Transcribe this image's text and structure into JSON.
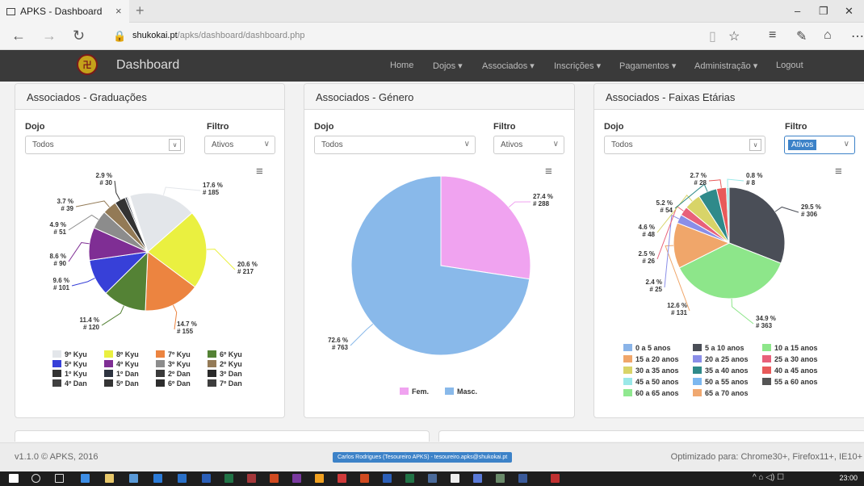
{
  "browser": {
    "tab_title": "APKS - Dashboard",
    "tab_close": "×",
    "new_tab": "+",
    "url_host": "shukokai.pt",
    "url_path": "/apks/dashboard/dashboard.php",
    "back": "←",
    "forward": "→",
    "refresh": "↻",
    "minimize": "–",
    "restore": "❐",
    "close": "✕"
  },
  "navbar": {
    "brand": "Dashboard",
    "items": [
      "Home",
      "Dojos ▾",
      "Associados ▾",
      "Inscrições ▾",
      "Pagamentos ▾",
      "Administração ▾",
      "Logout"
    ]
  },
  "panels": {
    "grad": {
      "title": "Associados - Graduações",
      "dojo_label": "Dojo",
      "dojo_value": "Todos",
      "filter_label": "Filtro",
      "filter_value": "Ativos"
    },
    "genero": {
      "title": "Associados - Género",
      "dojo_label": "Dojo",
      "dojo_value": "Todos",
      "filter_label": "Filtro",
      "filter_value": "Ativos"
    },
    "faixas": {
      "title": "Associados - Faixas Etárias",
      "dojo_label": "Dojo",
      "dojo_value": "Todos",
      "filter_label": "Filtro",
      "filter_value": "Ativos"
    }
  },
  "chart_data": [
    {
      "type": "pie",
      "title": "",
      "series": [
        {
          "categories": [
            "9º Kyu",
            "8º Kyu",
            "7º Kyu",
            "6º Kyu",
            "5º Kyu",
            "4º Kyu",
            "3º Kyu",
            "2º Kyu",
            "1º Kyu",
            "1º Dan",
            "2º Dan",
            "3º Dan",
            "4º Dan",
            "5º Dan",
            "6º Dan",
            "7º Dan"
          ],
          "values": [
            185,
            217,
            155,
            120,
            101,
            90,
            51,
            39,
            30,
            5,
            3,
            2,
            1,
            1,
            1,
            1
          ],
          "percent": [
            17.6,
            20.6,
            14.7,
            11.4,
            9.6,
            8.6,
            4.9,
            3.7,
            2.9,
            0.5,
            0.3,
            0.2,
            0.1,
            0.1,
            0.1,
            0.1
          ],
          "colors": [
            "#e3e6ea",
            "#eaf040",
            "#ec8440",
            "#548235",
            "#3740d8",
            "#7f2e94",
            "#8c8c8c",
            "#937a56",
            "#333333",
            "#2e3440",
            "#3a3a3a",
            "#2a2a2a",
            "#404040",
            "#353535",
            "#2d2d2d",
            "#3d3d3d"
          ]
        }
      ],
      "labels": [
        {
          "pct": "17.6 %",
          "num": "# 185"
        },
        {
          "pct": "20.6 %",
          "num": "# 217"
        },
        {
          "pct": "14.7 %",
          "num": "# 155"
        },
        {
          "pct": "11.4 %",
          "num": "# 120"
        },
        {
          "pct": "9.6 %",
          "num": "# 101"
        },
        {
          "pct": "8.6 %",
          "num": "# 90"
        },
        {
          "pct": "4.9 %",
          "num": "# 51"
        },
        {
          "pct": "3.7 %",
          "num": "# 39"
        },
        {
          "pct": "2.9 %",
          "num": "# 30"
        }
      ],
      "legend": [
        "9º Kyu",
        "8º Kyu",
        "7º Kyu",
        "6º Kyu",
        "5º Kyu",
        "4º Kyu",
        "3º Kyu",
        "2º Kyu",
        "1º Kyu",
        "1º Dan",
        "2º Dan",
        "3º Dan",
        "4º Dan",
        "5º Dan",
        "6º Dan",
        "7º Dan"
      ]
    },
    {
      "type": "pie",
      "title": "",
      "series": [
        {
          "categories": [
            "Fem.",
            "Masc."
          ],
          "values": [
            288,
            763
          ],
          "percent": [
            27.4,
            72.6
          ],
          "colors": [
            "#f0a3f0",
            "#89b9ea"
          ]
        }
      ],
      "labels": [
        {
          "pct": "27.4 %",
          "num": "# 288"
        },
        {
          "pct": "72.6 %",
          "num": "# 763"
        }
      ],
      "legend": [
        "Fem.",
        "Masc."
      ]
    },
    {
      "type": "pie",
      "title": "",
      "series": [
        {
          "categories": [
            "0 a 5 anos",
            "5 a 10 anos",
            "10 a 15 anos",
            "15 a 20 anos",
            "20 a 25 anos",
            "25 a 30 anos",
            "30 a 35 anos",
            "35 a 40 anos",
            "40 a 45 anos",
            "45 a 50 anos",
            "50 a 55 anos",
            "55 a 60 anos",
            "60 a 65 anos",
            "65 a 70 anos"
          ],
          "values": [
            0,
            306,
            363,
            131,
            25,
            26,
            48,
            54,
            28,
            8
          ],
          "percent": [
            0,
            29.5,
            34.9,
            12.6,
            2.4,
            2.5,
            4.6,
            5.2,
            2.7,
            0.8
          ],
          "colors": [
            "#8ab4e8",
            "#4a4e57",
            "#8de68a",
            "#f0a66a",
            "#8a8ee8",
            "#e8607a",
            "#d8d468",
            "#2f8a8a",
            "#e85a5a",
            "#9ae8e8",
            "#7cb8f0",
            "#555555",
            "#90e890",
            "#f0a870"
          ]
        }
      ],
      "labels": [
        {
          "pct": "29.5 %",
          "num": "# 306"
        },
        {
          "pct": "34.9 %",
          "num": "# 363"
        },
        {
          "pct": "12.6 %",
          "num": "# 131"
        },
        {
          "pct": "2.4 %",
          "num": "# 25"
        },
        {
          "pct": "2.5 %",
          "num": "# 26"
        },
        {
          "pct": "4.6 %",
          "num": "# 48"
        },
        {
          "pct": "5.2 %",
          "num": "# 54"
        },
        {
          "pct": "2.7 %",
          "num": "# 28"
        },
        {
          "pct": "0.8 %",
          "num": "# 8"
        }
      ],
      "legend": [
        "0 a 5 anos",
        "5 a 10 anos",
        "10 a 15 anos",
        "15 a 20 anos",
        "20 a 25 anos",
        "25 a 30 anos",
        "30 a 35 anos",
        "35 a 40 anos",
        "40 a 45 anos",
        "45 a 50 anos",
        "50 a 55 anos",
        "55 a 60 anos",
        "60 a 65 anos",
        "65 a 70 anos"
      ]
    }
  ],
  "footer": {
    "version": "v1.1.0 © APKS, 2016",
    "user": "Carlos Rodrigues (Tesoureiro APKS) - tesoureiro.apks@shukokai.pt",
    "optim": "Optimizado para: Chrome30+, Firefox11+, IE10+"
  },
  "taskbar": {
    "clock": "23:00",
    "tray": "^ ⌂ ◁) ☐"
  }
}
